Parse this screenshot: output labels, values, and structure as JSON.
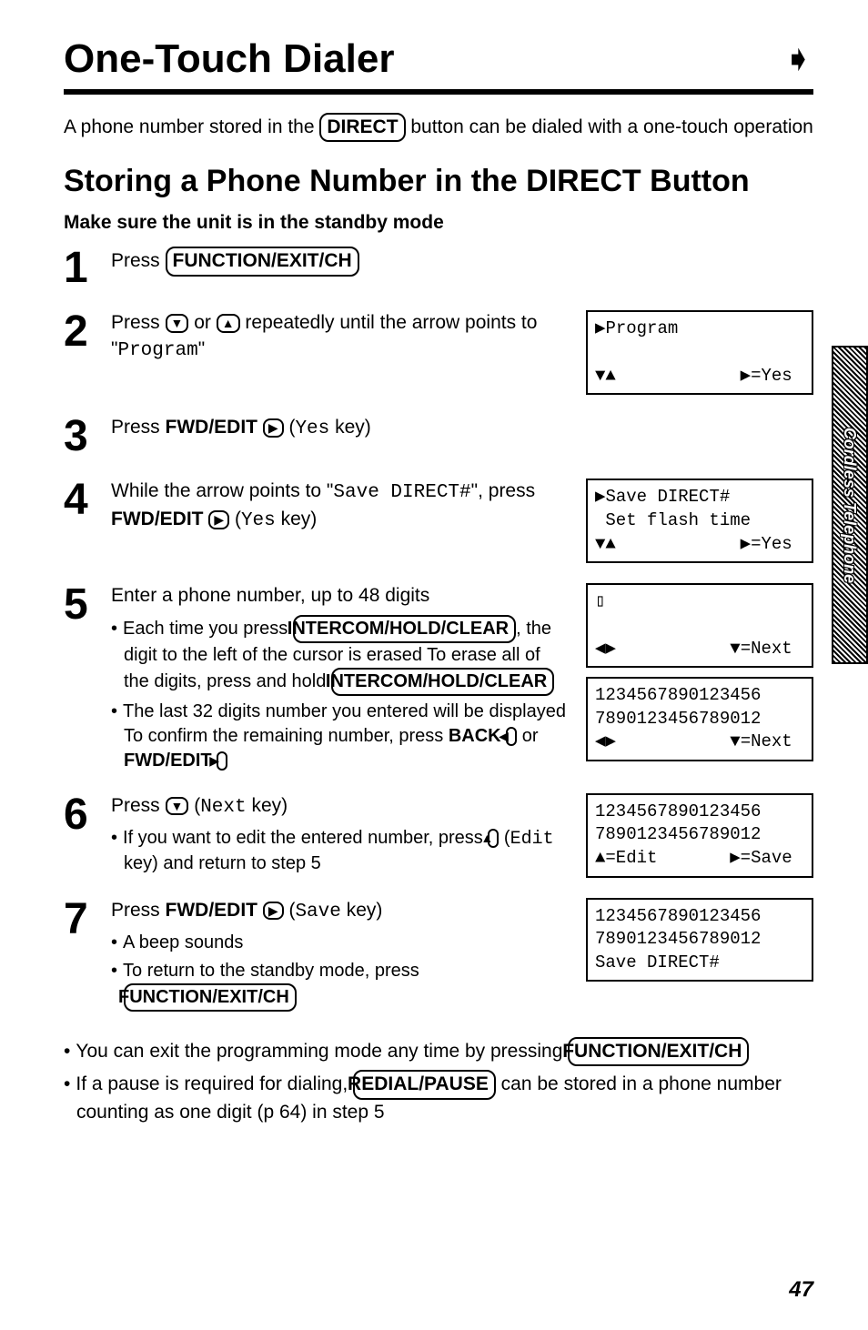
{
  "title": "One-Touch Dialer",
  "intro_a": "A phone number stored in the ",
  "intro_key": "DIRECT",
  "intro_b": " button can be dialed with a one-touch operation",
  "subhead": "Storing a Phone Number in the DIRECT Button",
  "standby": "Make sure the unit is in the standby mode",
  "step1_a": "Press ",
  "key_func": "FUNCTION/EXIT/CH",
  "step2_a": "Press ",
  "step2_b": " or ",
  "step2_c": " repeatedly until the arrow points to \"",
  "step2_mono": "Program",
  "step2_d": "\"",
  "lcd2_l1": "▶Program",
  "lcd2_l2": "                   ",
  "lcd2_l3": "▼▲            ▶=Yes",
  "step3_a": "Press ",
  "step3_b": "FWD/EDIT ",
  "step3_c": " (",
  "step3_mono": "Yes",
  "step3_d": " key)",
  "step4_a": "While the arrow points to \"",
  "step4_mono": "Save DIRECT#",
  "step4_b": "\", press ",
  "step4_c": "FWD/EDIT ",
  "step4_d": " (",
  "step4_mono2": "Yes",
  "step4_e": " key)",
  "lcd4_l1": "▶Save DIRECT#",
  "lcd4_l2": " Set flash time",
  "lcd4_l3": "▼▲            ▶=Yes",
  "step5_a": "Enter a phone number, up to 48 digits",
  "step5_s1a": "Each time you press ",
  "key_intercom": "INTERCOM/HOLD/CLEAR",
  "step5_s1b": ", the digit to the left of the cursor is erased  To erase all of the digits, press and hold ",
  "step5_s2a": "The last 32 digits number you entered will be displayed  To confirm the remaining number, press ",
  "step5_s2b": "BACK ",
  "step5_s2c": " or ",
  "step5_s2d": "FWD/EDIT ",
  "lcd5a_l1": "▯",
  "lcd5a_l2": "                   ",
  "lcd5a_l3": "◀▶           ▼=Next",
  "lcd5b_l1": "1234567890123456",
  "lcd5b_l2": "7890123456789012",
  "lcd5b_l3": "◀▶           ▼=Next",
  "step6_a": "Press ",
  "step6_b": " (",
  "step6_mono": "Next",
  "step6_c": " key)",
  "step6_s1a": "If you want to edit the entered number, press ",
  "step6_s1b": " (",
  "step6_s1mono": "Edit",
  "step6_s1c": " key) and return to step 5",
  "lcd6_l1": "1234567890123456",
  "lcd6_l2": "7890123456789012",
  "lcd6_l3": "▲=Edit       ▶=Save",
  "step7_a": "Press ",
  "step7_b": "FWD/EDIT ",
  "step7_c": " (",
  "step7_mono": "Save",
  "step7_d": " key)",
  "step7_s1": "A beep sounds",
  "step7_s2a": "To return to the standby mode, press ",
  "lcd7_l1": "1234567890123456",
  "lcd7_l2": "7890123456789012",
  "lcd7_l3": "Save DIRECT#",
  "note1a": "You can exit the programming mode any time by pressing ",
  "note2a": "If a pause is required for dialing, ",
  "key_redial": "REDIAL/PAUSE",
  "note2b": " can be stored in a phone number counting as one digit (p  64) in step 5",
  "pagenum": "47",
  "tab": "Cordless Telephone",
  "icon_down": "▼",
  "icon_up": "▲",
  "icon_right": "▶",
  "icon_left": "◀"
}
